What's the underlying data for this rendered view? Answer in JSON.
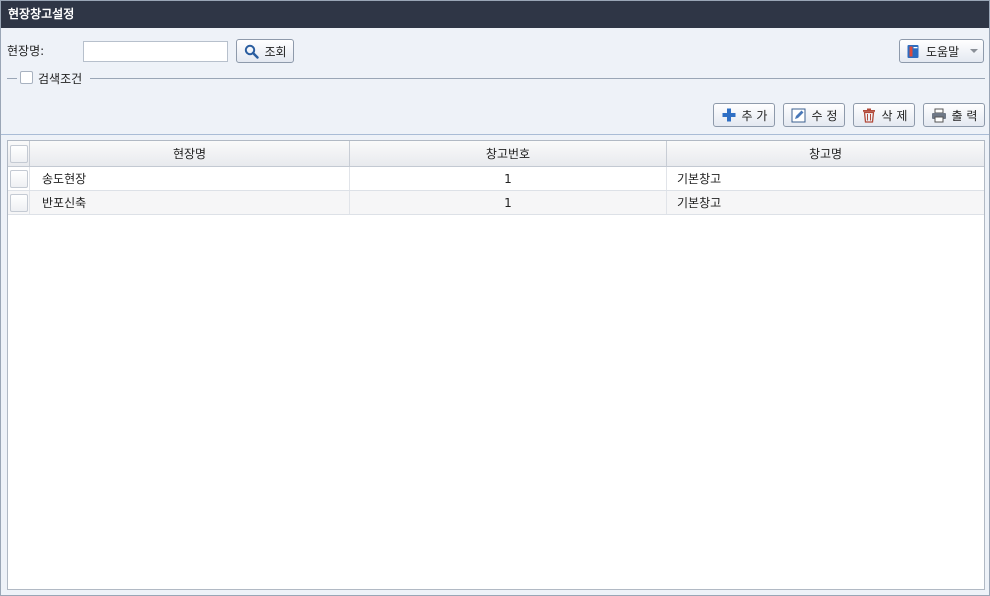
{
  "window": {
    "title": "현장창고설정"
  },
  "search": {
    "site_label": "현장명:",
    "site_value": "",
    "query_label": "조회",
    "help_label": "도움말",
    "conditions_label": "검색조건"
  },
  "toolbar": {
    "add_label": "추 가",
    "edit_label": "수 정",
    "delete_label": "삭 제",
    "print_label": "출 력"
  },
  "grid": {
    "columns": [
      "현장명",
      "창고번호",
      "창고명"
    ],
    "rows": [
      {
        "site": "송도현장",
        "no": "1",
        "name": "기본창고"
      },
      {
        "site": "반포신축",
        "no": "1",
        "name": "기본창고"
      }
    ]
  },
  "colors": {
    "titlebar": "#2f3646",
    "panel": "#eef2f8"
  }
}
